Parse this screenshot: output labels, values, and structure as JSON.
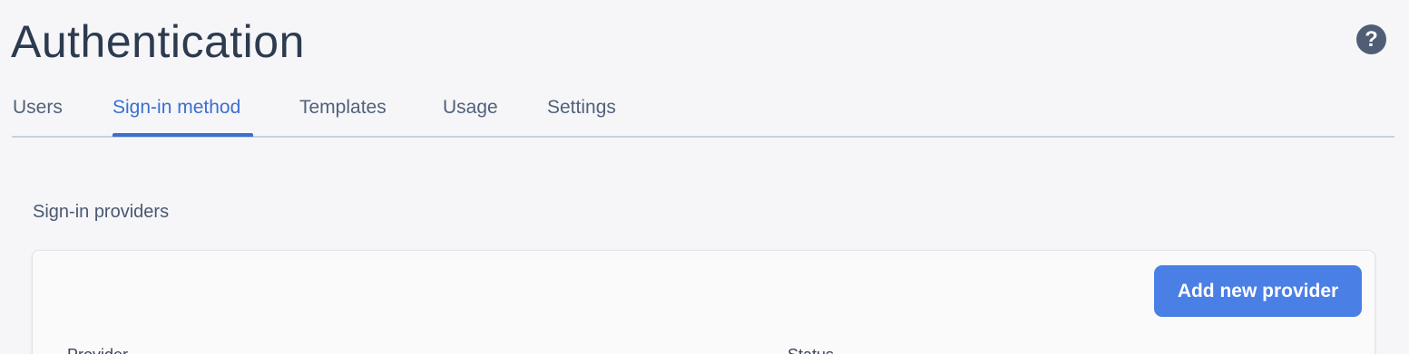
{
  "header": {
    "title": "Authentication",
    "help_icon": "help-circle-icon"
  },
  "tabs": [
    {
      "label": "Users",
      "active": false
    },
    {
      "label": "Sign-in method",
      "active": true
    },
    {
      "label": "Templates",
      "active": false
    },
    {
      "label": "Usage",
      "active": false
    },
    {
      "label": "Settings",
      "active": false
    }
  ],
  "providers": {
    "heading": "Sign-in providers",
    "add_button_label": "Add new provider",
    "columns": [
      "Provider",
      "Status"
    ]
  },
  "colors": {
    "accent": "#3b6fd0",
    "button": "#4a7fe6",
    "title": "#2d3b4f",
    "background": "#f6f6f9"
  }
}
